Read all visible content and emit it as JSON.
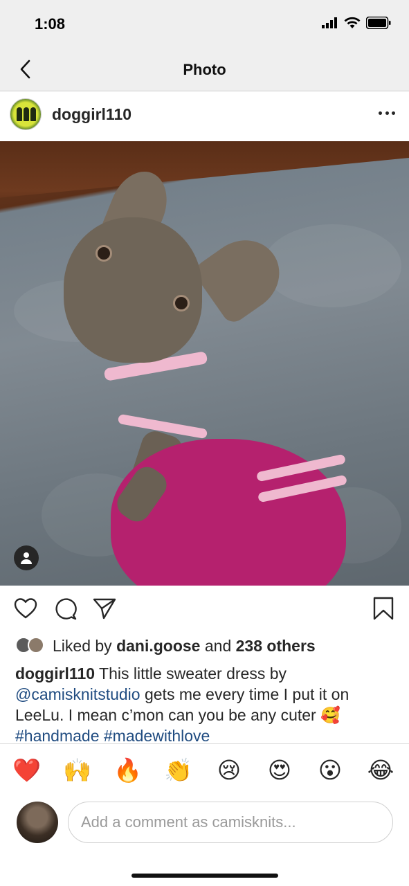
{
  "status_bar": {
    "time": "1:08"
  },
  "nav": {
    "title": "Photo"
  },
  "post": {
    "username": "doggirl110",
    "image_alt": "French bulldog wearing pink knit sweater dress on a grey blanket"
  },
  "likes": {
    "prefix": "Liked by",
    "user": "dani.goose",
    "and": "and",
    "others": "238 others"
  },
  "caption": {
    "user": "doggirl110",
    "text_1": "This little sweater dress by",
    "mention": "@camisknitstudio",
    "text_2": "gets me every time I put it on LeeLu. I mean c’mon can you be any cuter 🥰",
    "tag_1": "#handmade",
    "tag_2": "#madewithlove"
  },
  "emojis": [
    "❤️",
    "🙌",
    "🔥",
    "👏",
    "😢",
    "😍",
    "😮",
    "😂"
  ],
  "comment": {
    "placeholder": "Add a comment as camisknits..."
  },
  "colors": {
    "link": "#1f4b80",
    "heart": "#e0202a",
    "bar_bg": "#efefef"
  }
}
